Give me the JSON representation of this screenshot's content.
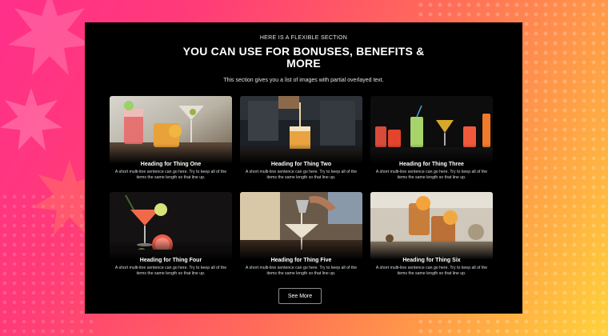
{
  "section": {
    "eyebrow": "HERE IS A FLEXIBLE SECTION",
    "title": "YOU CAN USE FOR BONUSES, BENEFITS & MORE",
    "subtitle": "This section gives you a list of images with partial overlayed text."
  },
  "cards": [
    {
      "heading": "Heading for Thing One",
      "description": "A short multi-line sentence can go here. Try to keep all of the items the same length so that line up.",
      "image": "cocktail-glasses-citrus-image"
    },
    {
      "heading": "Heading for Thing Two",
      "description": "A short multi-line sentence can go here. Try to keep all of the items the same length so that line up.",
      "image": "bartender-pouring-image"
    },
    {
      "heading": "Heading for Thing Three",
      "description": "A short multi-line sentence can go here. Try to keep all of the items the same length so that line up.",
      "image": "row-of-cocktails-image"
    },
    {
      "heading": "Heading for Thing Four",
      "description": "A short multi-line sentence can go here. Try to keep all of the items the same length so that line up.",
      "image": "grapefruit-cocktail-image"
    },
    {
      "heading": "Heading for Thing Five",
      "description": "A short multi-line sentence can go here. Try to keep all of the items the same length so that line up.",
      "image": "straining-martini-image"
    },
    {
      "heading": "Heading for Thing Six",
      "description": "A short multi-line sentence can go here. Try to keep all of the items the same length so that line up.",
      "image": "old-fashioned-drinks-image"
    }
  ],
  "actions": {
    "see_more_label": "See More"
  },
  "colors": {
    "background_start": "#ff2f8a",
    "background_end": "#ffd23a",
    "panel": "#000000",
    "text": "#ffffff"
  }
}
